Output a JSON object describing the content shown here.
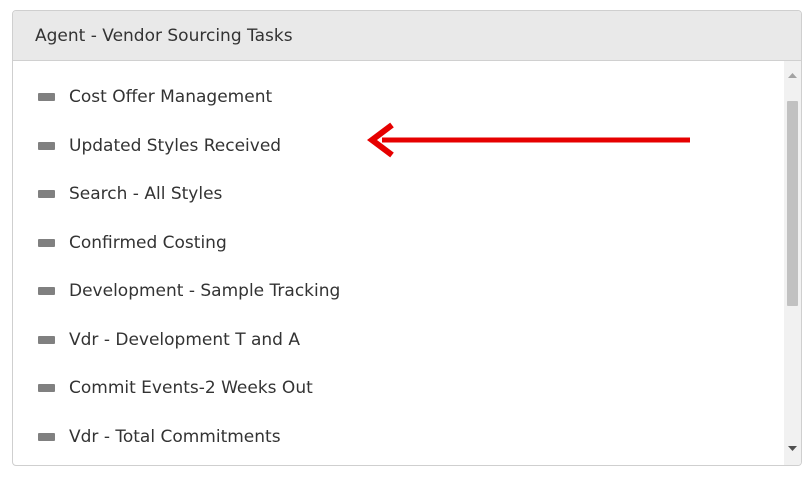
{
  "panel": {
    "title": "Agent - Vendor Sourcing Tasks"
  },
  "tasks": [
    {
      "label": "Cost Offer Management"
    },
    {
      "label": "Updated Styles Received"
    },
    {
      "label": "Search - All Styles"
    },
    {
      "label": "Confirmed Costing"
    },
    {
      "label": "Development - Sample Tracking"
    },
    {
      "label": "Vdr - Development T and A"
    },
    {
      "label": "Commit Events-2 Weeks Out"
    },
    {
      "label": "Vdr - Total Commitments"
    }
  ],
  "colors": {
    "header_bg": "#e9e9e9",
    "bullet": "#808080",
    "annotation_arrow": "#e60000",
    "scroll_thumb": "#c1c1c1"
  },
  "icons": {
    "bullet": "square-bullet-icon",
    "scroll_up": "scroll-up-arrow-icon",
    "scroll_down": "scroll-down-arrow-icon",
    "annotation": "red-arrow-left-icon"
  },
  "annotation": {
    "points_to_task": "Updated Styles Received"
  }
}
